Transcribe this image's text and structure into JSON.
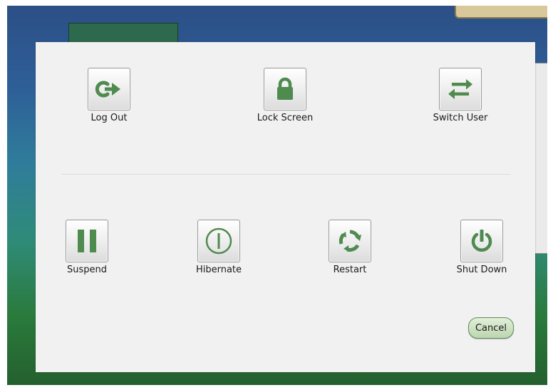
{
  "colors": {
    "accent": "#4f8a4f",
    "dialog_bg": "#f1f1f1"
  },
  "session_actions": [
    {
      "label": "Log Out",
      "icon": "logout-icon"
    },
    {
      "label": "Lock Screen",
      "icon": "lock-icon"
    },
    {
      "label": "Switch User",
      "icon": "switch-user-icon"
    }
  ],
  "power_actions": [
    {
      "label": "Suspend",
      "icon": "pause-icon"
    },
    {
      "label": "Hibernate",
      "icon": "hibernate-icon"
    },
    {
      "label": "Restart",
      "icon": "restart-icon"
    },
    {
      "label": "Shut Down",
      "icon": "power-icon"
    }
  ],
  "cancel_label": "Cancel"
}
